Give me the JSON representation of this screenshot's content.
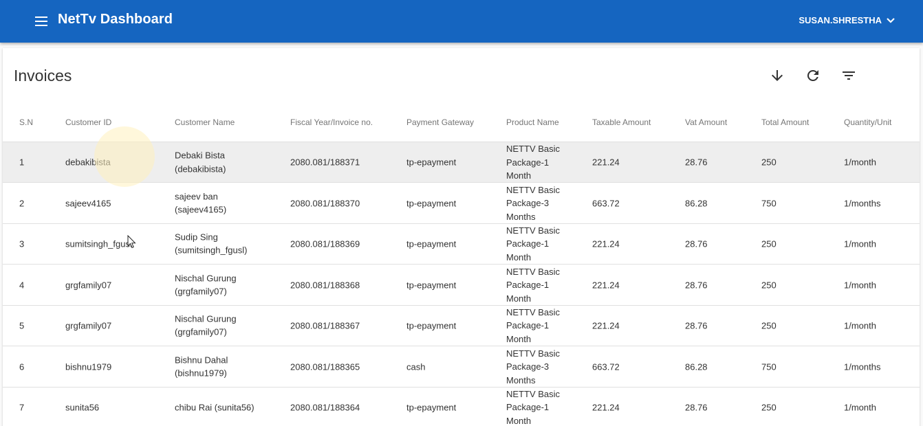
{
  "appbar": {
    "title": "NetTv Dashboard",
    "user": "SUSAN.SHRESTHA",
    "menu_icon": "menu-icon",
    "user_chevron_icon": "chevron-down-icon",
    "color": "#1565c0"
  },
  "invoices": {
    "title": "Invoices",
    "tools": [
      "download-icon",
      "refresh-icon",
      "filter-icon"
    ],
    "columns": [
      "S.N",
      "Customer ID",
      "Customer Name",
      "Fiscal Year/Invoice no.",
      "Payment Gateway",
      "Product Name",
      "Taxable Amount",
      "Vat Amount",
      "Total Amount",
      "Quantity/Unit"
    ],
    "rows": [
      {
        "sn": "1",
        "customer_id": "debakibista",
        "name_line1": "Debaki Bista",
        "name_line2": "(debakibista)",
        "invoice": "2080.081/188371",
        "gateway": "tp-epayment",
        "product_line1": "NETTV Basic",
        "product_line2": "Package-1",
        "product_line3": "Month",
        "taxable": "221.24",
        "vat": "28.76",
        "total": "250",
        "quantity": "1/month"
      },
      {
        "sn": "2",
        "customer_id": "sajeev4165",
        "name_line1": "sajeev ban",
        "name_line2": "(sajeev4165)",
        "invoice": "2080.081/188370",
        "gateway": "tp-epayment",
        "product_line1": "NETTV Basic",
        "product_line2": "Package-3",
        "product_line3": "Months",
        "taxable": "663.72",
        "vat": "86.28",
        "total": "750",
        "quantity": "1/months"
      },
      {
        "sn": "3",
        "customer_id": "sumitsingh_fgusl",
        "name_line1": "Sudip Sing",
        "name_line2": "(sumitsingh_fgusl)",
        "invoice": "2080.081/188369",
        "gateway": "tp-epayment",
        "product_line1": "NETTV Basic",
        "product_line2": "Package-1",
        "product_line3": "Month",
        "taxable": "221.24",
        "vat": "28.76",
        "total": "250",
        "quantity": "1/month"
      },
      {
        "sn": "4",
        "customer_id": "grgfamily07",
        "name_line1": "Nischal Gurung",
        "name_line2": "(grgfamily07)",
        "invoice": "2080.081/188368",
        "gateway": "tp-epayment",
        "product_line1": "NETTV Basic",
        "product_line2": "Package-1",
        "product_line3": "Month",
        "taxable": "221.24",
        "vat": "28.76",
        "total": "250",
        "quantity": "1/month"
      },
      {
        "sn": "5",
        "customer_id": "grgfamily07",
        "name_line1": "Nischal Gurung",
        "name_line2": "(grgfamily07)",
        "invoice": "2080.081/188367",
        "gateway": "tp-epayment",
        "product_line1": "NETTV Basic",
        "product_line2": "Package-1",
        "product_line3": "Month",
        "taxable": "221.24",
        "vat": "28.76",
        "total": "250",
        "quantity": "1/month"
      },
      {
        "sn": "6",
        "customer_id": "bishnu1979",
        "name_line1": "Bishnu Dahal",
        "name_line2": "(bishnu1979)",
        "invoice": "2080.081/188365",
        "gateway": "cash",
        "product_line1": "NETTV Basic",
        "product_line2": "Package-3",
        "product_line3": "Months",
        "taxable": "663.72",
        "vat": "86.28",
        "total": "750",
        "quantity": "1/months"
      },
      {
        "sn": "7",
        "customer_id": "sunita56",
        "name_line1": "chibu Rai (sunita56)",
        "name_line2": "",
        "invoice": "2080.081/188364",
        "gateway": "tp-epayment",
        "product_line1": "NETTV Basic",
        "product_line2": "Package-1",
        "product_line3": "Month",
        "taxable": "221.24",
        "vat": "28.76",
        "total": "250",
        "quantity": "1/month"
      }
    ]
  }
}
